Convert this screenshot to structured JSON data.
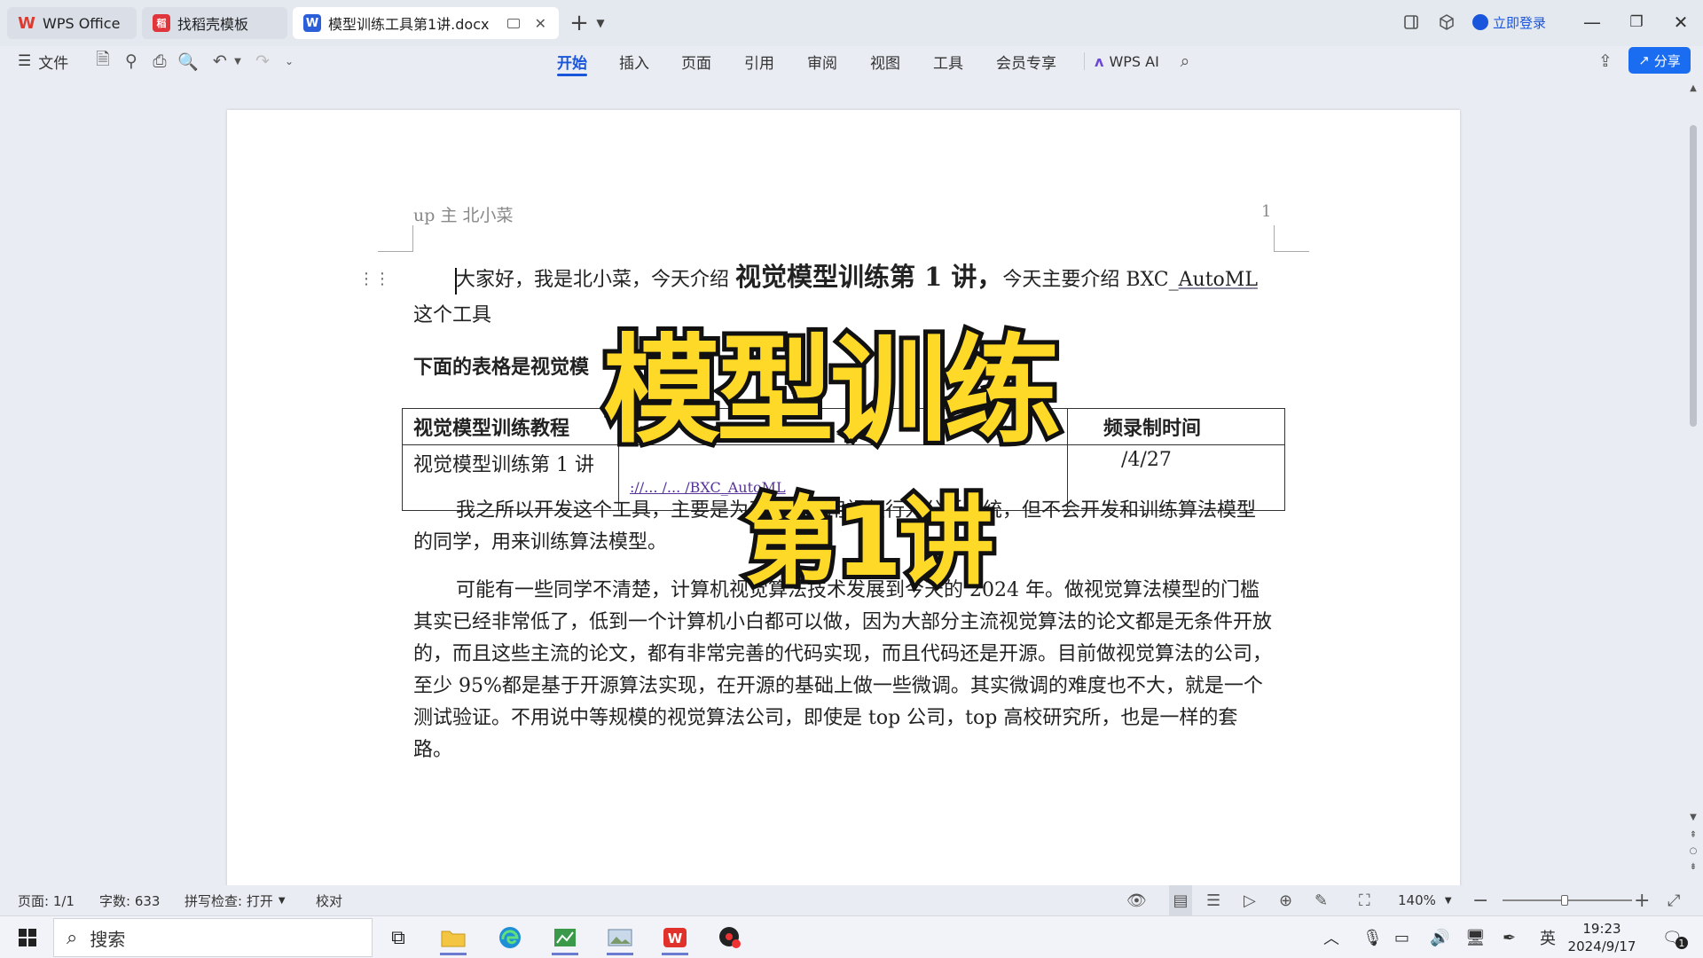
{
  "tabs": [
    {
      "label": "WPS Office",
      "logo": "W",
      "color": "#e03a2f"
    },
    {
      "label": "找稻壳模板",
      "logo": "稻",
      "color": "#e0353a"
    },
    {
      "label": "模型训练工具第1讲.docx",
      "logo": "W",
      "color": "#2b5fd9"
    }
  ],
  "titlebar": {
    "login_label": "立即登录"
  },
  "ribbon": {
    "file_label": "文件",
    "menu_tabs": [
      "开始",
      "插入",
      "页面",
      "引用",
      "审阅",
      "视图",
      "工具",
      "会员专享"
    ],
    "active_tab": "开始",
    "ai_label": "WPS AI",
    "share_label": "分享"
  },
  "document": {
    "header_left": "up 主  北小菜",
    "header_page": "1",
    "p1_a": "大家好，我是北小菜，今天介绍 ",
    "p1_big": "视觉模型训练第 1 讲，",
    "p1_b": "今天主要介绍 BXC_",
    "p1_c": "AutoML",
    "p1_line2": "这个工具",
    "table_intro": "下面的表格是视觉模",
    "table": {
      "header": [
        "视觉模型训练教程",
        "",
        "频录制时间"
      ],
      "row": [
        "视觉模型训练第 1 讲",
        "://...       /...      /BXC_AutoML",
        "/4/27"
      ]
    },
    "p2": "我之所以开发这个工具，主要是为了方便使用视频行为分析系统，但不会开发和训练算法模型的同学，用来训练算法模型。",
    "p3": "可能有一些同学不清楚，计算机视觉算法技术发展到今天的 2024 年。做视觉算法模型的门槛其实已经非常低了，低到一个计算机小白都可以做，因为大部分主流视觉算法的论文都是无条件开放的，而且这些主流的论文，都有非常完善的代码实现，而且代码还是开源。目前做视觉算法的公司，至少 95%都是基于开源算法实现，在开源的基础上做一些微调。其实微调的难度也不大，就是一个测试验证。不用说中等规模的视觉算法公司，即使是 top 公司，top 高校研究所，也是一样的套路。"
  },
  "overlay": {
    "title": "模型训练",
    "subtitle": "第1讲"
  },
  "status": {
    "page": "页面: 1/1",
    "words": "字数: 633",
    "spell": "拼写检查: 打开",
    "proof": "校对",
    "zoom": "140%"
  },
  "taskbar": {
    "search_placeholder": "搜索",
    "ime": "英",
    "time": "19:23",
    "date": "2024/9/17",
    "notification_count": "1"
  },
  "colors": {
    "accent": "#1a56db",
    "caption_yellow": "#ffd928"
  }
}
